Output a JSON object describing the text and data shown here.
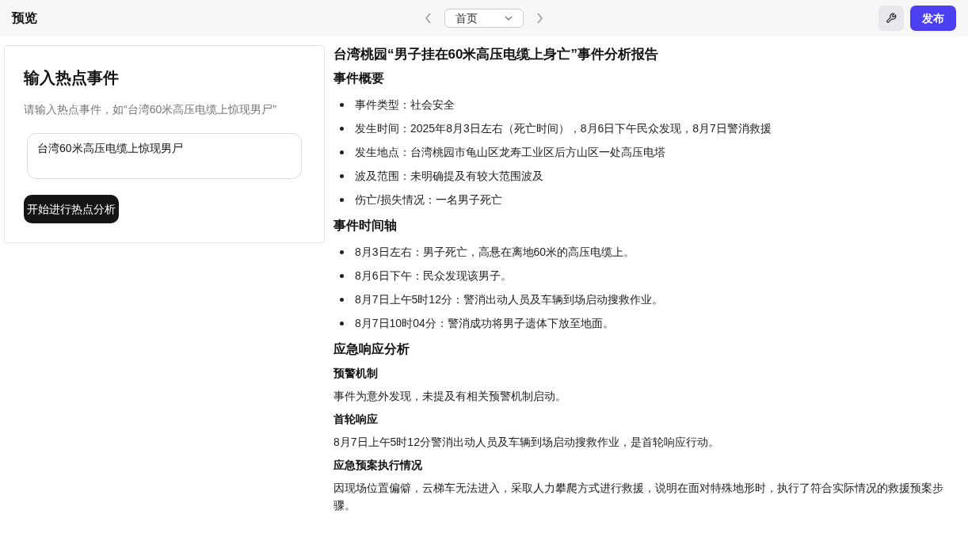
{
  "topbar": {
    "title": "预览",
    "page_select": "首页",
    "publish": "发布"
  },
  "input_card": {
    "title": "输入热点事件",
    "hint": "请输入热点事件，如“台湾60米高压电缆上惊现男尸”",
    "value": "台湾60米高压电缆上惊现男尸",
    "button": "开始进行热点分析"
  },
  "report": {
    "title": "台湾桃园“男子挂在60米高压电缆上身亡”事件分析报告",
    "blocks": [
      {
        "kind": "h2",
        "text": "事件概要"
      },
      {
        "kind": "bullets",
        "items": [
          "事件类型：社会安全",
          "发生时间：2025年8月3日左右（死亡时间），8月6日下午民众发现，8月7日警消救援",
          "发生地点：台湾桃园市龟山区龙寿工业区后方山区一处高压电塔",
          "波及范围：未明确提及有较大范围波及",
          "伤亡/损失情况：一名男子死亡"
        ]
      },
      {
        "kind": "h2",
        "text": "事件时间轴"
      },
      {
        "kind": "bullets",
        "items": [
          "8月3日左右：男子死亡，高悬在离地60米的高压电缆上。",
          "8月6日下午：民众发现该男子。",
          "8月7日上午5时12分：警消出动人员及车辆到场启动搜救作业。",
          "8月7日10时04分：警消成功将男子遗体下放至地面。"
        ]
      },
      {
        "kind": "h2",
        "text": "应急响应分析"
      },
      {
        "kind": "h3",
        "text": "预警机制"
      },
      {
        "kind": "paragraph",
        "text": "事件为意外发现，未提及有相关预警机制启动。"
      },
      {
        "kind": "h3",
        "text": "首轮响应"
      },
      {
        "kind": "paragraph",
        "text": "8月7日上午5时12分警消出动人员及车辆到场启动搜救作业，是首轮响应行动。"
      },
      {
        "kind": "h3",
        "text": "应急预案执行情况"
      },
      {
        "kind": "paragraph",
        "text": "因现场位置偏僻，云梯车无法进入，采取人力攀爬方式进行救援，说明在面对特殊地形时，执行了符合实际情况的救援预案步骤。"
      }
    ]
  }
}
